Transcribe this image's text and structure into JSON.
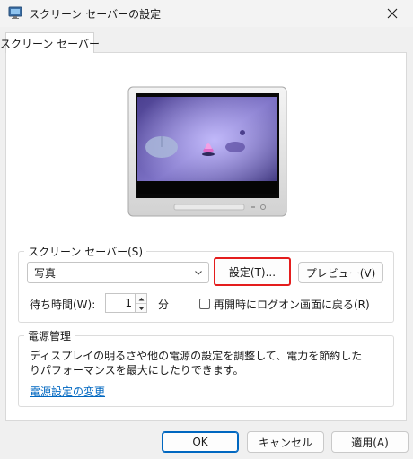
{
  "window": {
    "title": "スクリーン セーバーの設定"
  },
  "tab": {
    "label": "スクリーン セーバー"
  },
  "screensaver": {
    "group_label": "スクリーン セーバー(S)",
    "selected": "写真",
    "settings_label": "設定(T)...",
    "preview_label": "プレビュー(V)",
    "wait_label": "待ち時間(W):",
    "wait_value": "1",
    "wait_unit": "分",
    "resume_label": "再開時にログオン画面に戻る(R)",
    "resume_checked": false
  },
  "power": {
    "group_label": "電源管理",
    "description": "ディスプレイの明るさや他の電源の設定を調整して、電力を節約したりパフォーマンスを最大にしたりできます。",
    "link_label": "電源設定の変更"
  },
  "footer": {
    "ok_label": "OK",
    "cancel_label": "キャンセル",
    "apply_label": "適用(A)"
  },
  "colors": {
    "accent": "#0067c0",
    "focus_ring": "#e41d1d"
  }
}
